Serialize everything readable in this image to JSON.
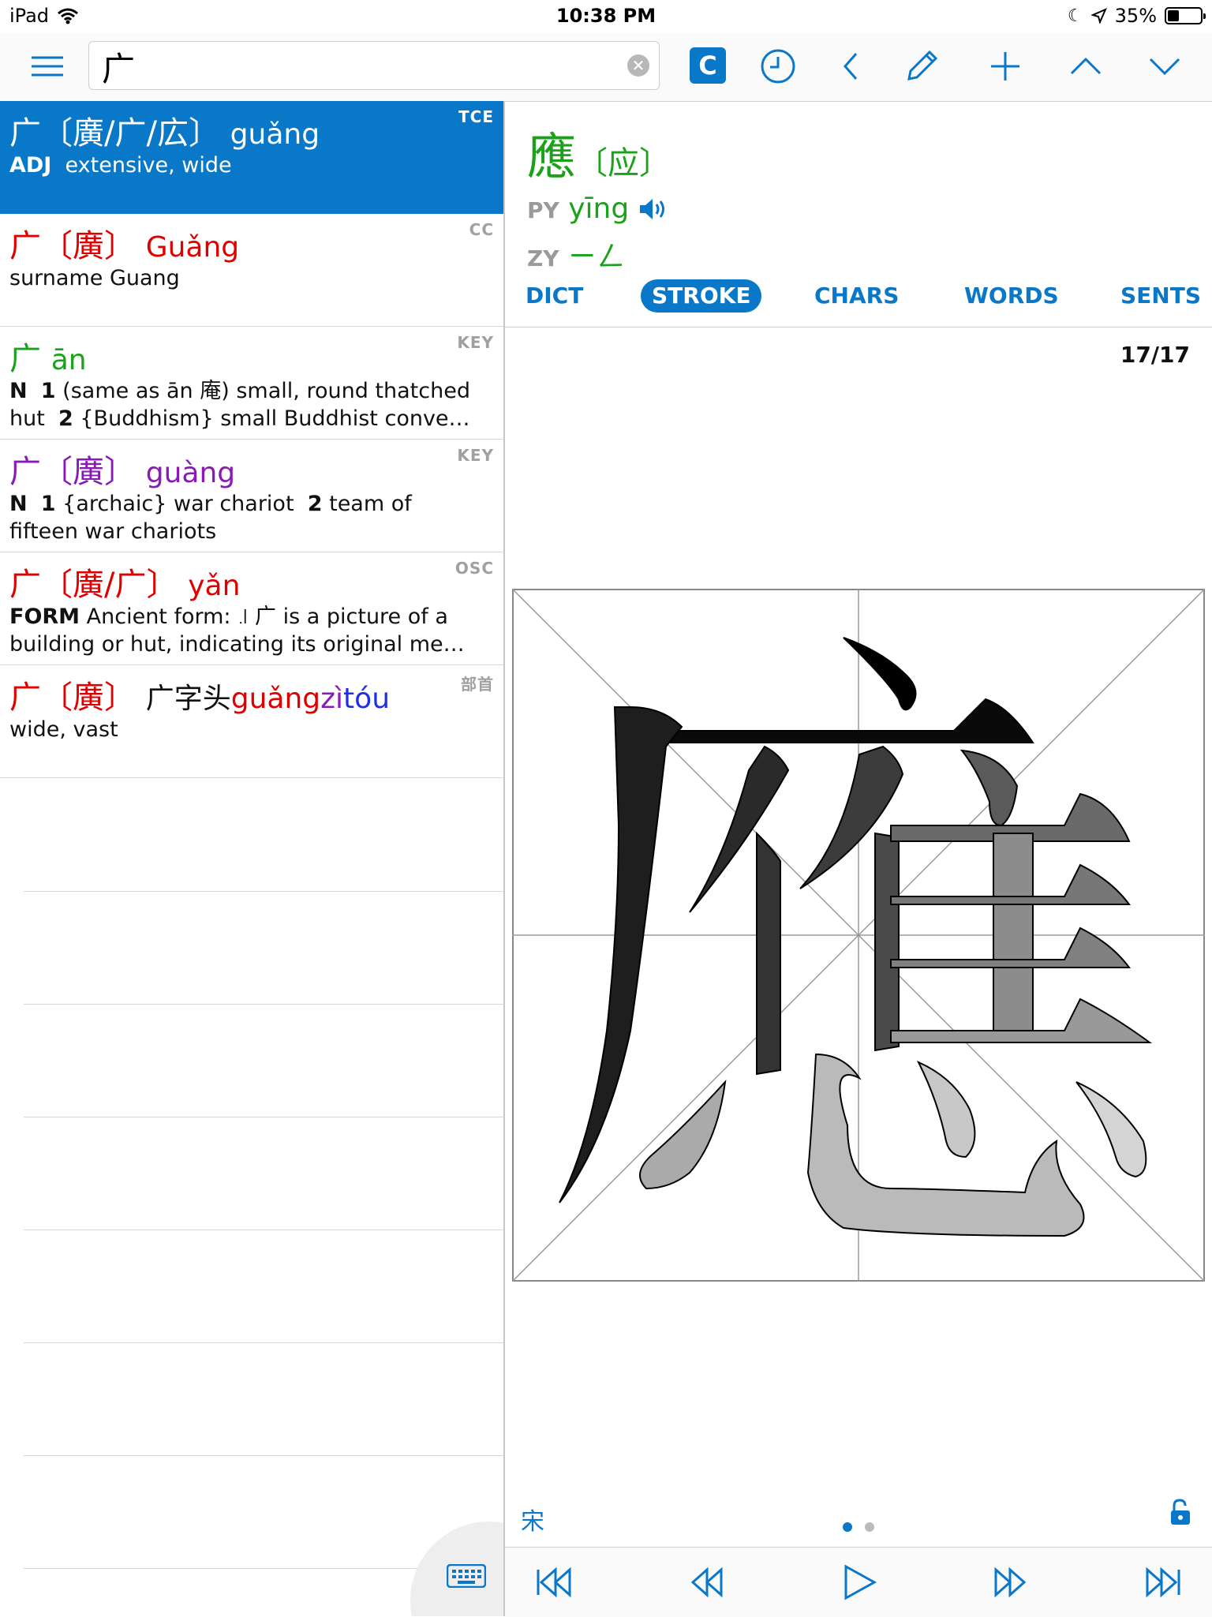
{
  "status_bar": {
    "device": "iPad",
    "time": "10:38 PM",
    "battery": "35%",
    "battery_level": 0.35
  },
  "toolbar": {
    "search_value": "广",
    "c_label": "C",
    "icons": [
      "menu-icon",
      "clear-icon",
      "history-icon",
      "back-icon",
      "edit-icon",
      "add-icon",
      "up-icon",
      "down-icon"
    ]
  },
  "results": [
    {
      "head": "广",
      "trad": "〔廣/广/広〕",
      "pinyin": "guǎng",
      "source": "TCE",
      "pos": "ADJ",
      "definition": "extensive, wide",
      "color": "#ffffff"
    },
    {
      "head": "广",
      "trad": "〔廣〕",
      "pinyin": "Guǎng",
      "source": "CC",
      "definition": "surname Guang",
      "color": "#e00000"
    },
    {
      "head": "广",
      "pinyin": "ān",
      "source": "KEY",
      "pos": "N",
      "def_n1": "1",
      "def_text1": "(same as ān 庵) small, round thatched hut",
      "def_n2": "2",
      "def_text2": "{Buddhism} small Buddhist conve…",
      "color": "#1aa31a"
    },
    {
      "head": "广",
      "trad": "〔廣〕",
      "pinyin": "guàng",
      "source": "KEY",
      "pos": "N",
      "def_n1": "1",
      "def_text1": "{archaic} war chariot",
      "def_n2": "2",
      "def_text2": "team of fifteen war chariots",
      "color": "#8a1ab8"
    },
    {
      "head": "广",
      "trad": "〔廣/广〕",
      "pinyin": "yǎn",
      "source": "OSC",
      "pos": "FORM",
      "definition": "Ancient form: ꜌ 广 is a picture of a building or hut, indicating its original me…",
      "color": "#e00000"
    },
    {
      "head": "广",
      "trad": "〔廣〕",
      "extra": "广字头",
      "pinyin_a": "guǎng",
      "pinyin_b": "zì",
      "pinyin_c": "tóu",
      "source": "部首",
      "definition": "wide, vast",
      "color": "#e00000"
    }
  ],
  "detail": {
    "character": "應",
    "simplified": "〔应〕",
    "py_label": "PY",
    "pinyin": "yīng",
    "zy_label": "ZY",
    "zhuyin": "ㄧㄥ",
    "tabs": [
      "DICT",
      "STROKE",
      "CHARS",
      "WORDS",
      "SENTS"
    ],
    "active_tab": "STROKE",
    "stroke_counter": "17/17",
    "font_label": "宋",
    "page": 1,
    "pages": 2
  },
  "colors": {
    "accent": "#0a78c8",
    "green": "#1aa31a",
    "red": "#e00000",
    "purple": "#8a1ab8",
    "blue": "#2030e0"
  },
  "playback_icons": [
    "first-stroke-icon",
    "prev-stroke-icon",
    "play-icon",
    "next-stroke-icon",
    "last-stroke-icon"
  ]
}
